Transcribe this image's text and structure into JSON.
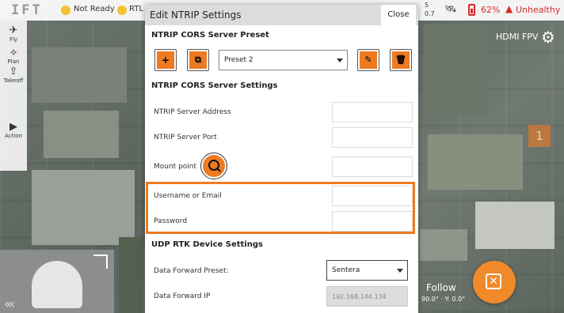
{
  "app": {
    "logo": "IFT",
    "status": "Not Ready",
    "rtl_label": "RTL",
    "top_right_values": [
      "5",
      "0.7"
    ],
    "battery": "62%",
    "health": "Unhealthy",
    "accent_color": "#ee7a22",
    "alert_color": "#d62a2a"
  },
  "left_toolbar": {
    "items": [
      {
        "label": "Fly",
        "icon": "fly-icon"
      },
      {
        "label": "Plan",
        "icon": "plan-icon"
      },
      {
        "label": "Takeoff",
        "icon": "takeoff-icon"
      },
      {
        "label": "Action",
        "icon": "play-icon"
      }
    ]
  },
  "right_panel": {
    "hdmi": "HDMI FPV",
    "marker_number": "1",
    "follow_label": "Follow",
    "follow_sub": "90.0° · Y: 0.0°"
  },
  "modal": {
    "title": "Edit NTRIP Settings",
    "close_label": "Close",
    "preset_section": "NTRIP CORS Server Preset",
    "preset_value": "Preset 2",
    "server_section": "NTRIP CORS Server Settings",
    "fields": {
      "address_label": "NTRIP Server Address",
      "port_label": "NTRIP Server Port",
      "mount_label": "Mount point",
      "username_label": "Username or Email",
      "password_label": "Password"
    },
    "udp_section": "UDP RTK Device Settings",
    "forward_preset_label": "Data Forward Preset:",
    "forward_preset_value": "Sentera",
    "forward_ip_label": "Data Forward IP",
    "forward_ip_placeholder": "192.168.144.134"
  }
}
